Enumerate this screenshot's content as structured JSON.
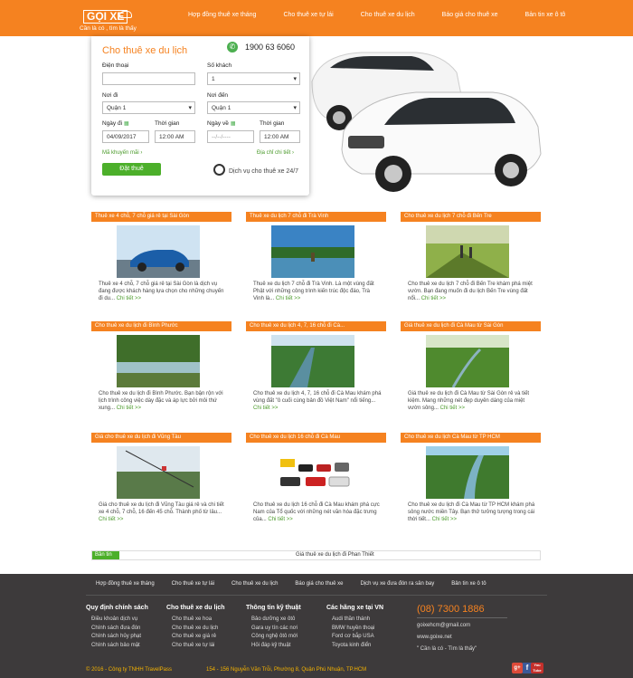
{
  "logo": {
    "text": "GỌI XE",
    "slogan": "Cần là có , tìm là thấy"
  },
  "nav": [
    "Hợp đồng thuê xe tháng",
    "Cho thuê xe tự lái",
    "Cho thuê xe du lịch",
    "Báo giá cho thuê xe",
    "Bản tin xe ô tô"
  ],
  "form": {
    "title": "Cho thuê xe du lịch",
    "phone": "1900 63 6060",
    "phone_label": "Điện thoại",
    "seats_label": "Số khách",
    "seats_value": "1",
    "from_label": "Nơi đi",
    "from_value": "Quận 1",
    "to_label": "Nơi đến",
    "to_value": "Quận 1",
    "date_label": "Ngày đi",
    "time_label": "Thời gian",
    "date_value": "04/09/2017",
    "time_value": "12:00 AM",
    "ret_label": "Ngày về",
    "ret_time_label": "Thời gian",
    "ret_value": "--/--/----",
    "ret_time_value": "12:00 AM",
    "promo": "Mã khuyến mãi ›",
    "address": "Địa chỉ chi tiết ›",
    "submit": "Đặt thuê",
    "service": "Dịch vụ cho thuê xe 24/7"
  },
  "cards": [
    {
      "title": "Thuê xe 4 chỗ, 7 chỗ giá rẻ tại Sài Gòn",
      "text": "Thuê xe 4 chỗ, 7 chỗ giá rẻ tại Sài Gòn là dịch vụ đang được khách hàng lựa chọn cho những chuyến đi du...",
      "more": "Chi tiết >>",
      "scene": "car"
    },
    {
      "title": "Thuê xe du lịch 7 chỗ đi Trà Vinh",
      "text": "Thuê xe du lịch 7 chỗ đi Trà Vinh. Là một vùng đất Phật với những công trình kiến trúc độc đáo, Trà Vinh là...",
      "more": "Chi tiết >>",
      "scene": "lake"
    },
    {
      "title": "Cho thuê xe du lịch 7 chỗ đi Bến Tre",
      "text": "Cho thuê xe du lịch 7 chỗ đi Bến Tre khám phá miệt vườn. Bạn đang muốn đi du lịch Bến Tre vùng đất nổi...",
      "more": "Chi tiết >>",
      "scene": "garden"
    },
    {
      "title": "Cho thuê xe du lịch đi Bình Phước",
      "text": "Cho thuê xe du lịch đi Bình Phước. Bạn bận rộn với lịch trình công việc dày đặc và áp lực bởi môi thứ xung...",
      "more": "Chi tiết >>",
      "scene": "river"
    },
    {
      "title": "Cho thuê xe du lịch 4, 7, 16 chỗ đi Cà...",
      "text": "Cho thuê xe du lịch 4, 7, 16 chỗ đi Cà Mau khám phá vùng đất \"ô cuối cùng bản đồ Việt Nam\" nổi tiếng...",
      "more": "Chi tiết >>",
      "scene": "canal"
    },
    {
      "title": "Giá thuê xe du lịch đi Cà Mau từ Sài Gòn",
      "text": "Giá thuê xe du lịch đi Cà Mau từ Sài Gòn rẻ và tiết kiệm. Mang những nét đẹp duyên dáng của miệt vườn sông...",
      "more": "Chi tiết >>",
      "scene": "forest"
    },
    {
      "title": "Giá cho thuê xe du lịch đi Vũng Tàu",
      "text": "Giá cho thuê xe du lịch đi Vũng Tàu giá rẻ và chi tiết xe 4 chỗ, 7 chỗ, 16 đến 45 chỗ. Thành phố từ lâu...",
      "more": "Chi tiết >>",
      "scene": "cable"
    },
    {
      "title": "Cho thuê xe du lịch 16 chỗ đi Cà Mau",
      "text": "Cho thuê xe du lịch 16 chỗ đi Cà Mau khám phá cực Nam của Tổ quốc với những nét văn hóa đặc trưng của...",
      "more": "Chi tiết >>",
      "scene": "fleet"
    },
    {
      "title": "Cho thuê xe du lịch Cà Mau từ TP HCM",
      "text": "Cho thuê xe du lịch đi Cà Mau từ TP HCM khám phá sông nước miền Tây. Bạn thử tưởng tượng trong cái thời tiết...",
      "more": "Chi tiết >>",
      "scene": "canal2"
    }
  ],
  "news": {
    "label": "Bản tin",
    "text": "Giá thuê xe du lịch đi Phan Thiết"
  },
  "footer": {
    "nav": [
      "Hợp đồng thuê xe tháng",
      "Cho thuê xe tự lái",
      "Cho thuê xe du lịch",
      "Báo giá cho thuê xe",
      "Dịch vụ xe đưa đón ra sân bay",
      "Bản tin xe ô tô"
    ],
    "cols": [
      {
        "heading": "Quy định chính sách",
        "items": [
          "Điều khoản dịch vụ",
          "Chính sách đưa đón",
          "Chính sách hủy phạt",
          "Chính sách bảo mật"
        ]
      },
      {
        "heading": "Cho thuê xe du lịch",
        "items": [
          "Cho thuê xe hoa",
          "Cho thuê xe du lịch",
          "Cho thuê xe giá rẻ",
          "Cho thuê xe tự lái"
        ]
      },
      {
        "heading": "Thông tin kỹ thuật",
        "items": [
          "Bảo dưỡng xe ôtô",
          "Gara uy tín các nơi",
          "Công nghệ ôtô mới",
          "Hỏi đáp kỹ thuật"
        ]
      },
      {
        "heading": "Các hãng xe tại VN",
        "items": [
          "Audi thần thánh",
          "BMW huyền thoại",
          "Ford cơ bắp USA",
          "Toyota kinh điển"
        ]
      }
    ],
    "phone": "(08) 7300 1886",
    "email": "goixehcm@gmail.com",
    "website": "www.goixe.net",
    "slogan": "\" Cần là có - Tìm là thấy\"",
    "copyright": "© 2016 - Công ty TNHH TravelPass",
    "address": "154 - 156 Nguyễn Văn Trỗi, Phường 8, Quận Phú Nhuận, TP.HCM",
    "social": [
      "f",
      "g+",
      "You Tube"
    ]
  }
}
